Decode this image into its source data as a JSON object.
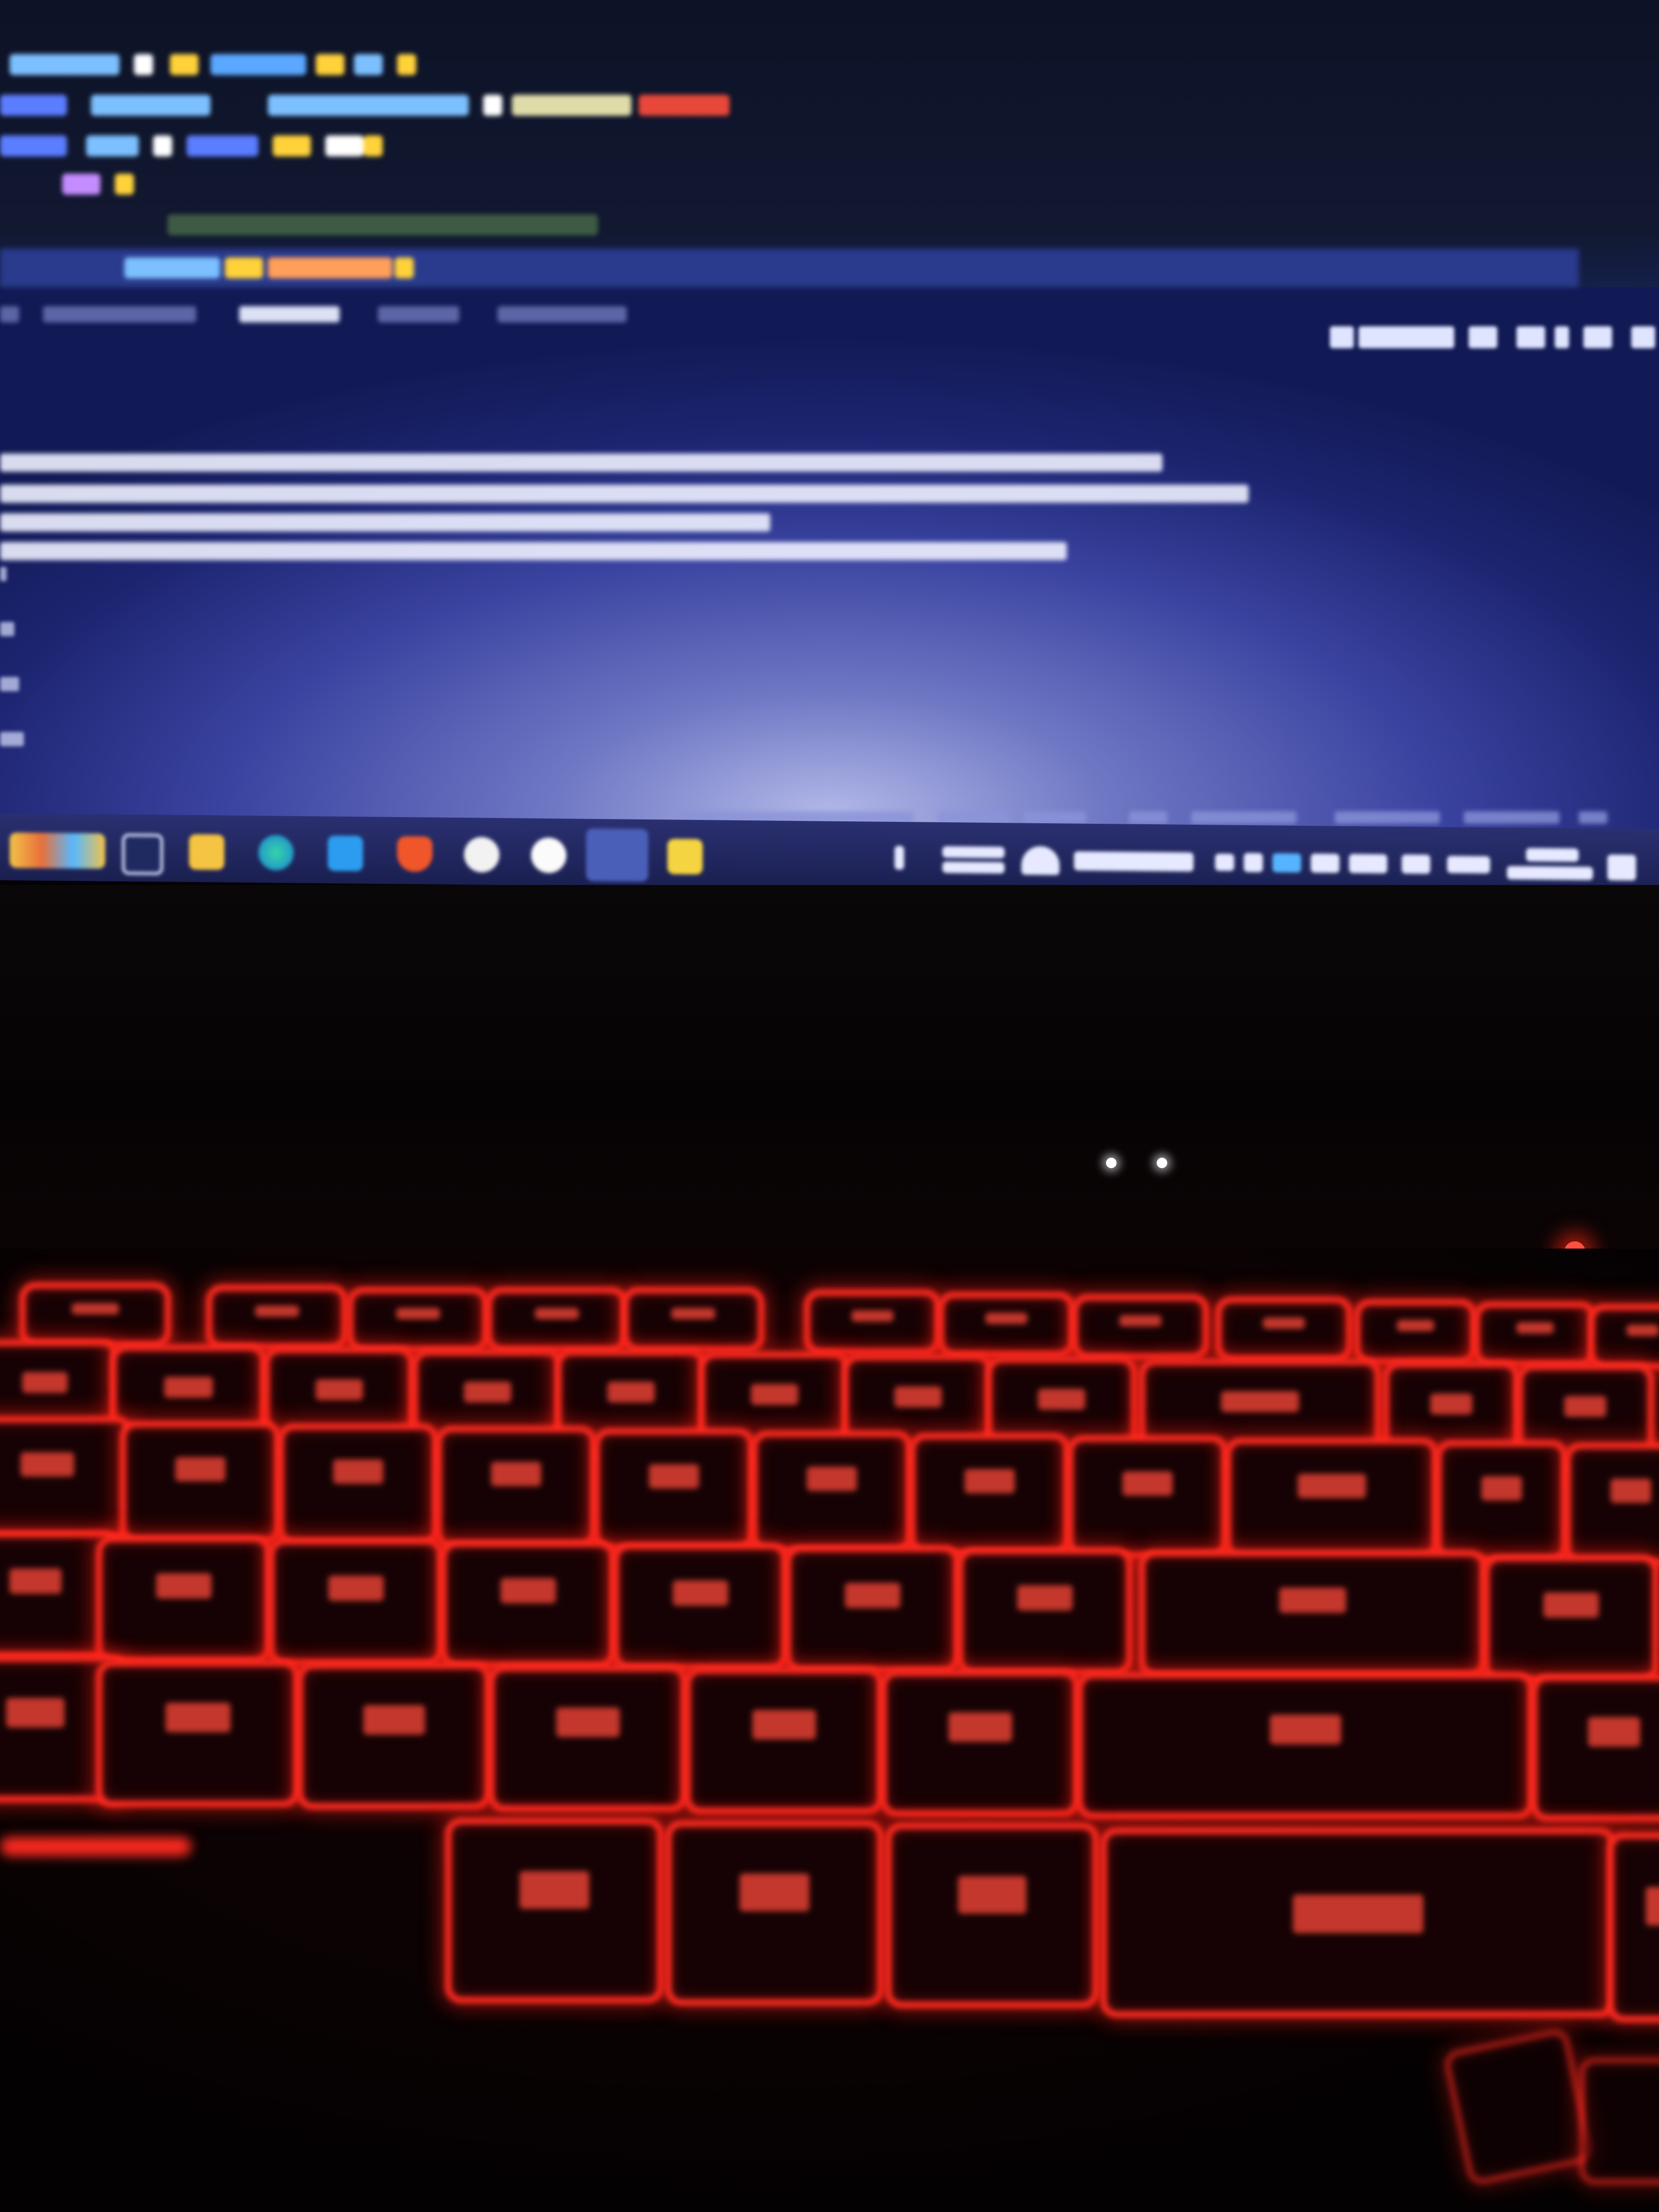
{
  "photo": {
    "subject": "laptop",
    "screen_app": "code-editor",
    "keyboard_backlight": "#ff2a20"
  },
  "editor": {
    "code_lines": [
      "Entryform = ({ props }) => {",
      "const [data.coded, setData.coded] = useState(false);",
      "const init = async () => {",
      "try {",
      "// is loading the bundle",
      "console.log(\"init\");"
    ],
    "panel_tabs": [
      "PROBLEMS",
      "DEBUG CONSOLE",
      "TERMINAL",
      "OUTPUT",
      "PORTS"
    ],
    "active_tab": "TERMINAL",
    "terminal_selector": "web-bun"
  },
  "terminal": {
    "lines": [
      "ender@http://192.168.0.105:19000/index.bundle?platform=android&dev=true&hot=false:8797:26",
      "ntComponent@http://192.168.0.105:19000/index.bundle?platform=android&dev=true&hot=false:70852:28",
      "\"md-list-box\" is not a valid icon name for family \"ionicons\"",
      "ttp://192.168.0.105:19000/index.bundle?platform=android&dev=true&hot=false:104042:38"
    ]
  },
  "taskbar": {
    "status": "Ln 11, Col 18 (11 selected)",
    "weather_text": "IPL",
    "weather_sub": "GT vs RR",
    "weather_label": "DPC Stnde",
    "lang": "ENG",
    "clock_time": "20:57",
    "clock_date": "28-03-2023",
    "icons": [
      "widgets-icon",
      "task-view-icon",
      "file-explorer-icon",
      "edge-icon",
      "store-icon",
      "brave-icon",
      "chat-icon",
      "chrome-icon",
      "vscode-icon",
      "notes-icon"
    ]
  }
}
